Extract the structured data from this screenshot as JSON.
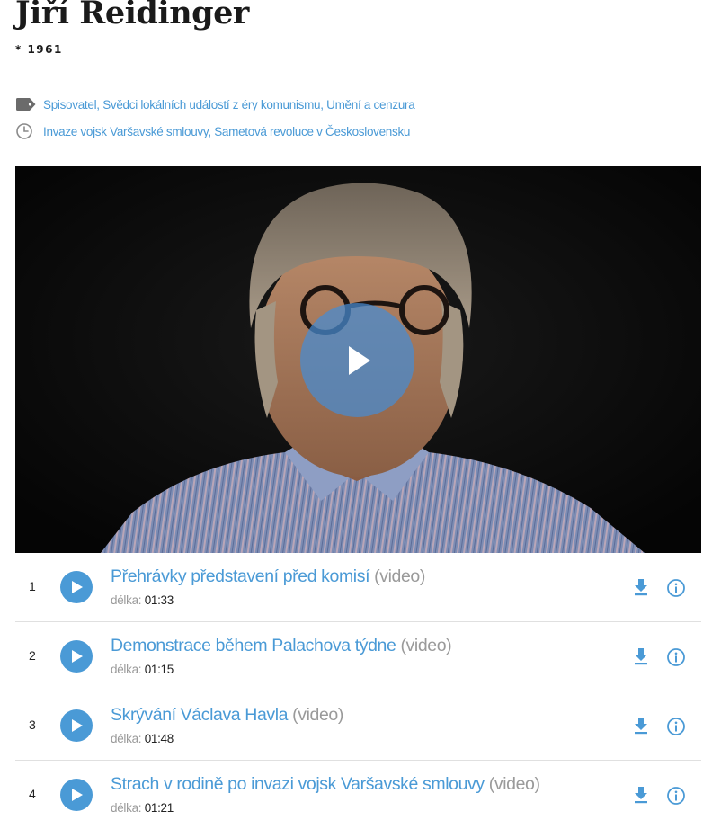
{
  "witness": {
    "name": "Jiří Reidinger",
    "birth": "* 1961"
  },
  "meta": {
    "categories_icon": "tag-icon",
    "categories": "Spisovatel, Svědci lokálních událostí z éry komunismu, Umění a cenzura",
    "periods_icon": "clock-icon",
    "periods": "Invaze vojsk Varšavské smlouvy, Sametová revoluce v Československu"
  },
  "player": {
    "play_icon": "play-icon"
  },
  "colors": {
    "accent": "#4a9ad6",
    "muted": "#9a9a9a",
    "text": "#222222"
  },
  "clips": [
    {
      "number": "1",
      "title": "Přehrávky představení před komisí",
      "type": "(video)",
      "duration_label": "délka:",
      "duration": "01:33"
    },
    {
      "number": "2",
      "title": "Demonstrace během Palachova týdne",
      "type": "(video)",
      "duration_label": "délka:",
      "duration": "01:15"
    },
    {
      "number": "3",
      "title": "Skrývání Václava Havla",
      "type": "(video)",
      "duration_label": "délka:",
      "duration": "01:48"
    },
    {
      "number": "4",
      "title": "Strach v rodině po invazi vojsk Varšavské smlouvy",
      "type": "(video)",
      "duration_label": "délka:",
      "duration": "01:21"
    }
  ]
}
